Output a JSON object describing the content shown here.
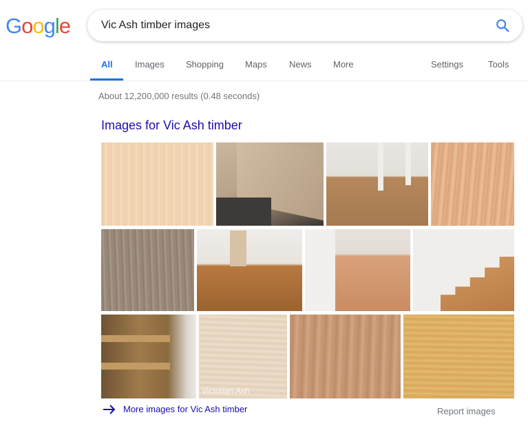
{
  "logo": {
    "letters": [
      "G",
      "o",
      "o",
      "g",
      "l",
      "e"
    ],
    "colors": [
      "#4285F4",
      "#EA4335",
      "#FBBC05",
      "#4285F4",
      "#34A853",
      "#EA4335"
    ]
  },
  "search": {
    "query": "Vic Ash timber images",
    "icon": "search-icon"
  },
  "tabs": [
    {
      "label": "All",
      "active": true
    },
    {
      "label": "Images"
    },
    {
      "label": "Shopping"
    },
    {
      "label": "Maps"
    },
    {
      "label": "News"
    },
    {
      "label": "More"
    },
    {
      "label": "Settings"
    },
    {
      "label": "Tools"
    }
  ],
  "results": {
    "stats": "About 12,200,000 results (0.48 seconds)"
  },
  "images_block": {
    "heading": "Images for Vic Ash timber",
    "watermark": "Victorian Ash",
    "more_link": "More images for Vic Ash timber",
    "report": "Report images"
  },
  "colors": {
    "accent": "#1a73e8",
    "link": "#1a0dab",
    "muted": "#70757a"
  }
}
